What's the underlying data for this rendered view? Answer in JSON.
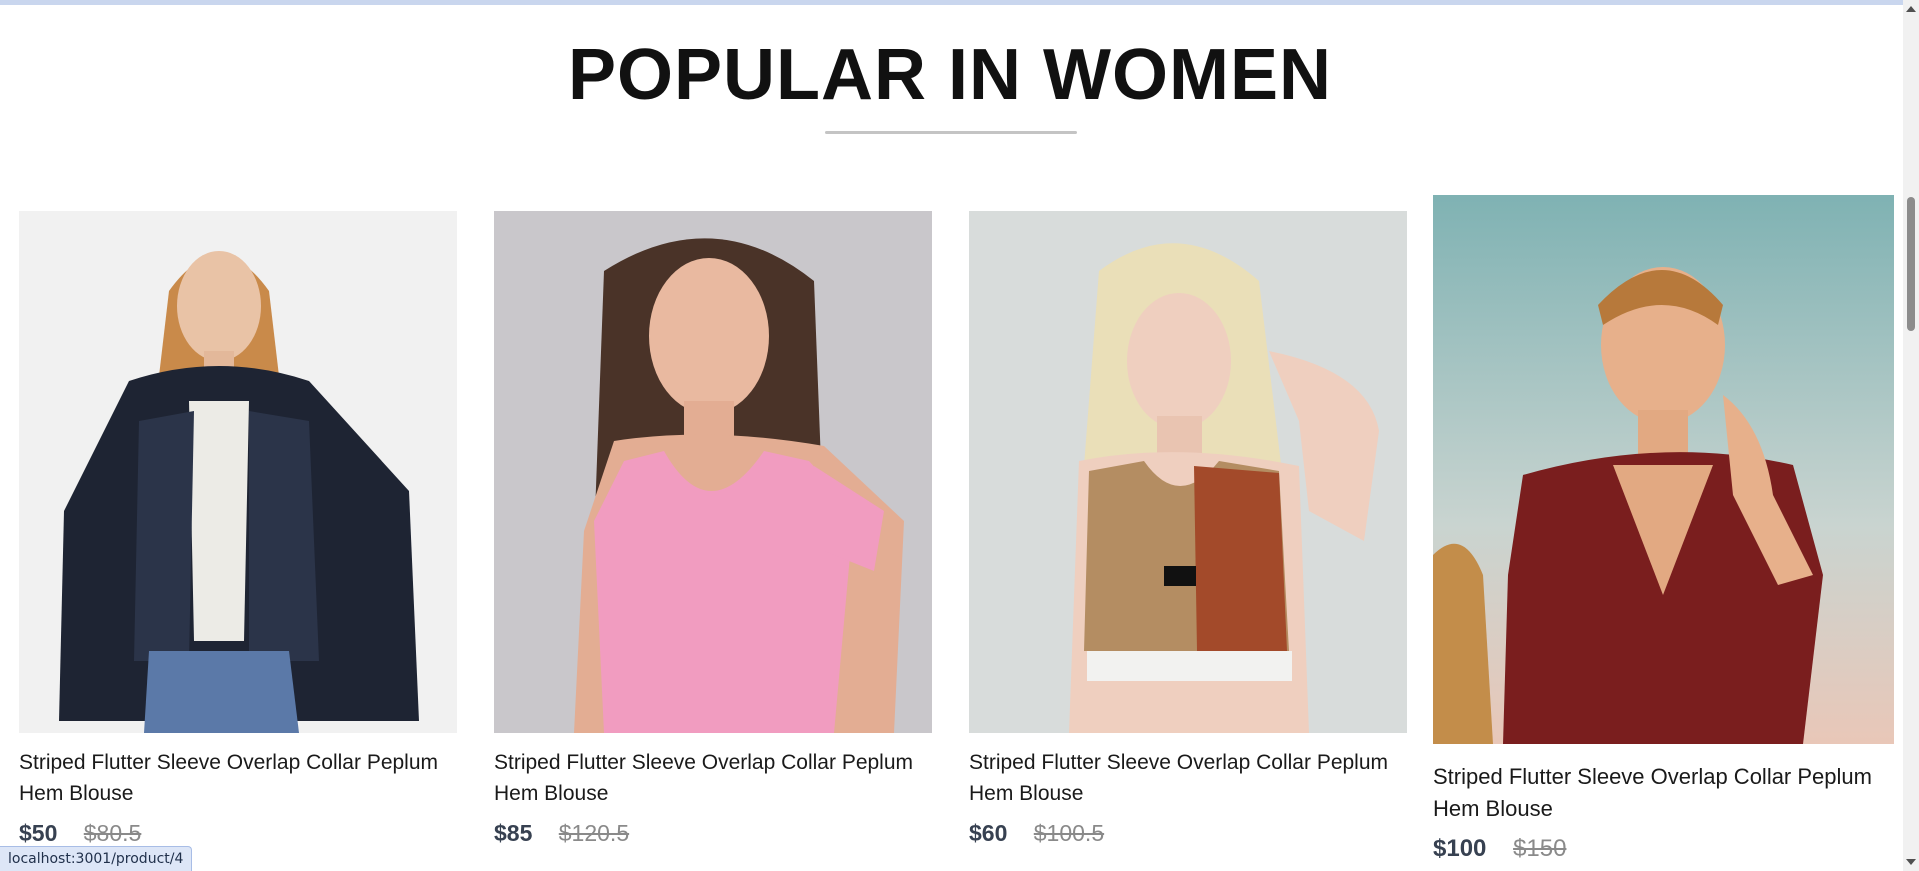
{
  "section": {
    "title": "POPULAR IN WOMEN"
  },
  "products": [
    {
      "name": "Striped Flutter Sleeve Overlap Collar Peplum Hem Blouse",
      "new_price": "$50",
      "old_price": "$80.5"
    },
    {
      "name": "Striped Flutter Sleeve Overlap Collar Peplum Hem Blouse",
      "new_price": "$85",
      "old_price": "$120.5"
    },
    {
      "name": "Striped Flutter Sleeve Overlap Collar Peplum Hem Blouse",
      "new_price": "$60",
      "old_price": "$100.5"
    },
    {
      "name": "Striped Flutter Sleeve Overlap Collar Peplum Hem Blouse",
      "new_price": "$100",
      "old_price": "$150"
    }
  ],
  "status_bar": {
    "url": "localhost:3001/product/4"
  }
}
